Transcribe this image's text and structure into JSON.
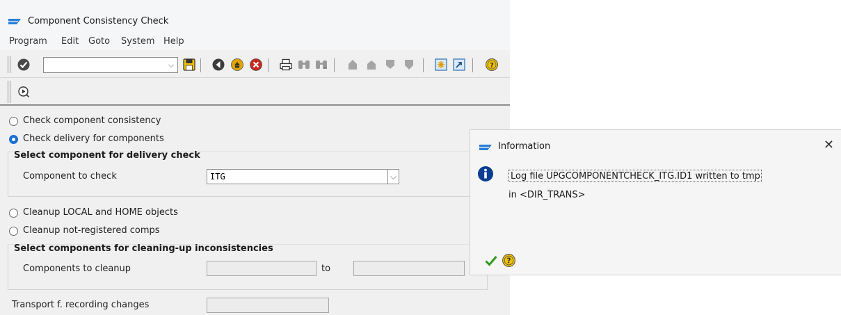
{
  "window": {
    "title": "Component Consistency Check"
  },
  "menu": [
    "Program",
    "Edit",
    "Goto",
    "System",
    "Help"
  ],
  "options": {
    "check_consistency": "Check component consistency",
    "check_delivery": "Check delivery for components",
    "cleanup_local_home": "Cleanup LOCAL and HOME objects",
    "cleanup_not_registered": "Cleanup not-registered comps"
  },
  "delivery_group": {
    "title": "Select component for delivery check",
    "component_label": "Component to check",
    "component_value": "ITG"
  },
  "cleanup_group": {
    "title": "Select components for cleaning-up inconsistencies",
    "components_label": "Components to cleanup",
    "to_label": "to",
    "from_value": "",
    "to_value": ""
  },
  "transport": {
    "label": "Transport f. recording changes",
    "value": ""
  },
  "dialog": {
    "title": "Information",
    "message_line1": "Log file UPGCOMPONENTCHECK_ITG.ID1 written to tmp",
    "message_line2": "in <DIR_TRANS>",
    "close_glyph": "✕"
  },
  "colors": {
    "accent_blue": "#1b6fd3",
    "confirm_green": "#2e9a1b",
    "help_yellow": "#f2c200"
  }
}
